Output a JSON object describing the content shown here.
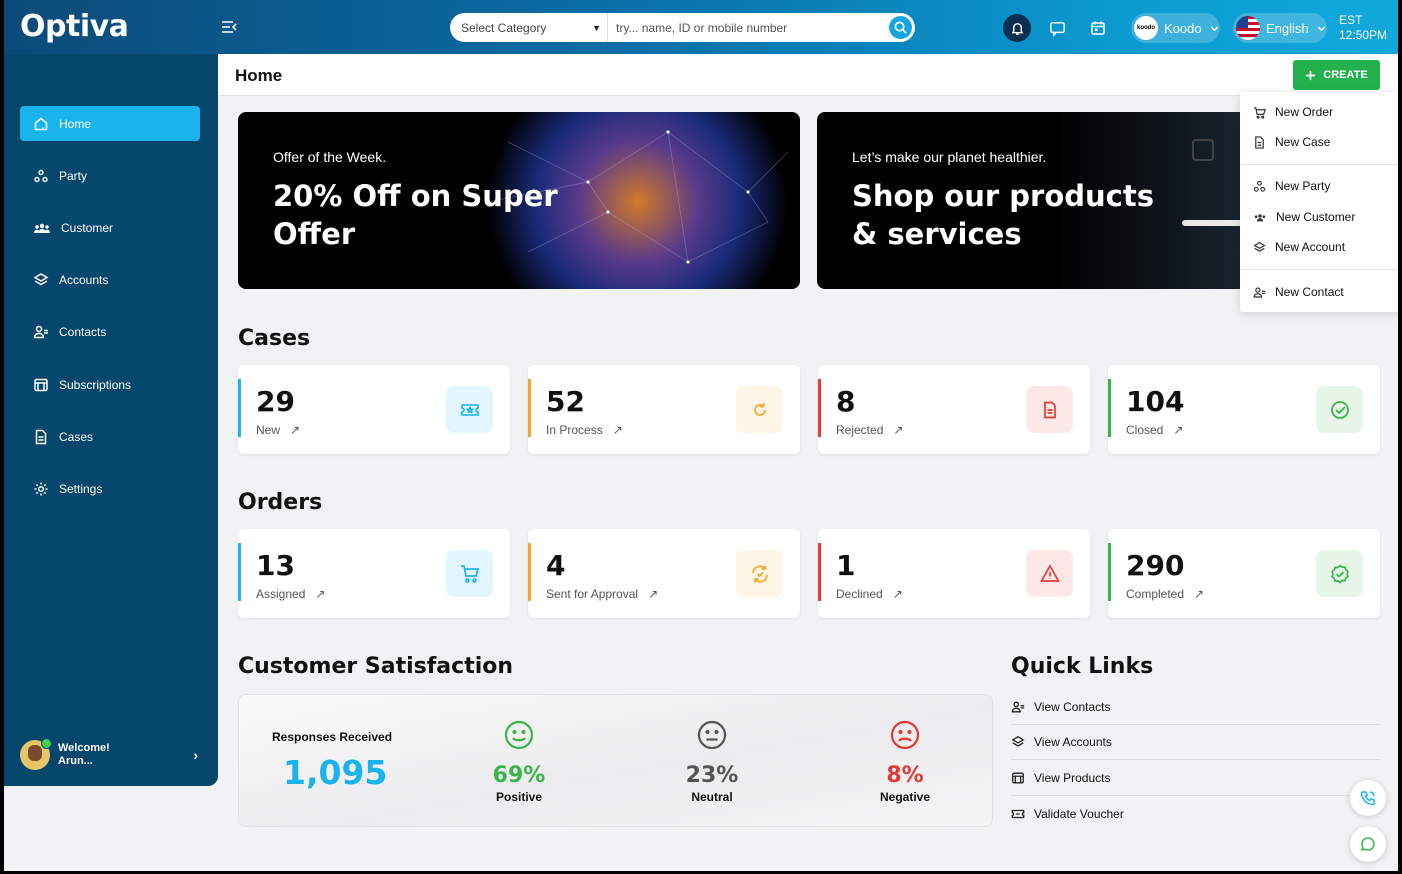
{
  "app": {
    "logo": "Optiva"
  },
  "topbar": {
    "category_select": "Select Category",
    "search_placeholder": "try... name, ID or mobile number",
    "brand": "Koodo",
    "brand_badge": "koodo",
    "language": "English",
    "timezone": "EST",
    "time": "12:50PM"
  },
  "sidebar": {
    "items": [
      {
        "label": "Home",
        "icon": "home-icon"
      },
      {
        "label": "Party",
        "icon": "party-icon"
      },
      {
        "label": "Customer",
        "icon": "customer-icon"
      },
      {
        "label": "Accounts",
        "icon": "accounts-icon"
      },
      {
        "label": "Contacts",
        "icon": "contacts-icon"
      },
      {
        "label": "Subscriptions",
        "icon": "subscriptions-icon"
      },
      {
        "label": "Cases",
        "icon": "cases-icon"
      },
      {
        "label": "Settings",
        "icon": "settings-icon"
      }
    ],
    "welcome": "Welcome!",
    "user": "Arun..."
  },
  "header": {
    "title": "Home",
    "create_label": "CREATE"
  },
  "create_menu": {
    "items": [
      "New Order",
      "New Case",
      "New Party",
      "New Customer",
      "New Account",
      "New Contact"
    ]
  },
  "banners": [
    {
      "kicker": "Offer of the Week.",
      "headline_1": "20% Off on Super",
      "headline_2": "Offer"
    },
    {
      "kicker": "Let’s make our planet healthier.",
      "headline_1": "Shop our products",
      "headline_2": "& services"
    }
  ],
  "cases": {
    "title": "Cases",
    "cards": [
      {
        "value": "29",
        "label": "New",
        "color": "#19b4ee",
        "icon": "ticket-icon"
      },
      {
        "value": "52",
        "label": "In Process",
        "color": "#f5a623",
        "icon": "refresh-icon"
      },
      {
        "value": "8",
        "label": "Rejected",
        "color": "#e53935",
        "icon": "document-icon"
      },
      {
        "value": "104",
        "label": "Closed",
        "color": "#3bb54a",
        "icon": "check-circle-icon"
      }
    ]
  },
  "orders": {
    "title": "Orders",
    "cards": [
      {
        "value": "13",
        "label": "Assigned",
        "color": "#19b4ee",
        "icon": "cart-icon"
      },
      {
        "value": "4",
        "label": "Sent for Approval",
        "color": "#f5a623",
        "icon": "sync-icon"
      },
      {
        "value": "1",
        "label": "Declined",
        "color": "#e53935",
        "icon": "warning-icon"
      },
      {
        "value": "290",
        "label": "Completed",
        "color": "#3bb54a",
        "icon": "badge-check-icon"
      }
    ]
  },
  "satisfaction": {
    "title": "Customer Satisfaction",
    "responses_label": "Responses Received",
    "responses": "1,095",
    "items": [
      {
        "pct": "69%",
        "label": "Positive",
        "color": "#3bb54a",
        "icon": "happy-face-icon"
      },
      {
        "pct": "23%",
        "label": "Neutral",
        "color": "#555555",
        "icon": "neutral-face-icon"
      },
      {
        "pct": "8%",
        "label": "Negative",
        "color": "#e53935",
        "icon": "sad-face-icon"
      }
    ]
  },
  "quick_links": {
    "title": "Quick Links",
    "items": [
      "View Contacts",
      "View Accounts",
      "View Products",
      "Validate Voucher"
    ]
  }
}
